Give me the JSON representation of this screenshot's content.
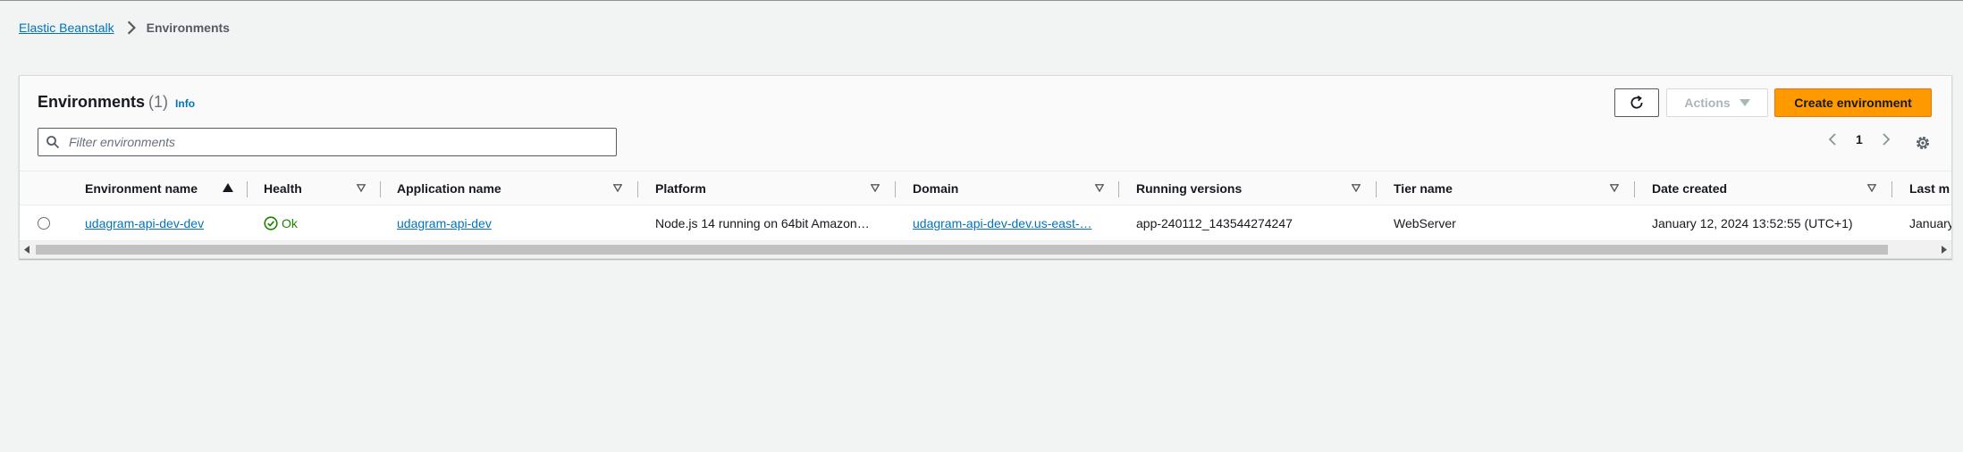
{
  "breadcrumb": {
    "root": "Elastic Beanstalk",
    "current": "Environments"
  },
  "panel": {
    "title": "Environments",
    "count": "(1)",
    "info": "Info",
    "actions_label": "Actions",
    "create_label": "Create environment",
    "filter_placeholder": "Filter environments",
    "page": "1"
  },
  "table": {
    "columns": [
      "Environment name",
      "Health",
      "Application name",
      "Platform",
      "Domain",
      "Running versions",
      "Tier name",
      "Date created",
      "Last m"
    ],
    "rows": [
      {
        "environment_name": "udagram-api-dev-dev",
        "health": "Ok",
        "application_name": "udagram-api-dev",
        "platform": "Node.js 14 running on 64bit Amazon…",
        "domain": "udagram-api-dev-dev.us-east-…",
        "running_versions": "app-240112_143544274247",
        "tier_name": "WebServer",
        "date_created": "January 12, 2024 13:52:55 (UTC+1)",
        "last_modified": "January"
      }
    ]
  },
  "colors": {
    "link": "#0073bb",
    "primary_button": "#ff9900",
    "ok_status": "#1d8102"
  },
  "icons": [
    "chevron-right-icon",
    "refresh-icon",
    "caret-down-icon",
    "search-icon",
    "chevron-left-icon",
    "settings-gear-icon",
    "sort-ascending-icon",
    "sort-descending-icon",
    "status-ok-icon"
  ]
}
